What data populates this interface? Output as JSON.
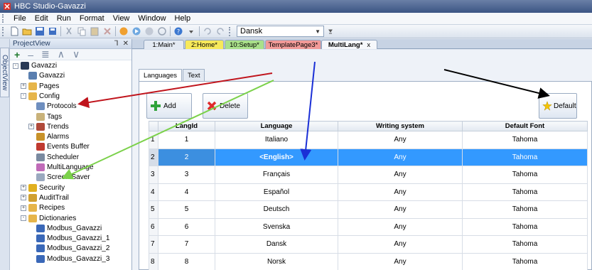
{
  "window": {
    "title": "HBC Studio-Gavazzi"
  },
  "menu": [
    "File",
    "Edit",
    "Run",
    "Format",
    "View",
    "Window",
    "Help"
  ],
  "toolbar": {
    "language_selected": "Dansk"
  },
  "side_tab": {
    "label": "ObjectView"
  },
  "project_view": {
    "title": "ProjectView",
    "pin": "⅂",
    "close": "✕",
    "tree": [
      {
        "label": "Gavazzi",
        "exp": "-",
        "icon": "monitor-icon"
      },
      {
        "label": "Gavazzi",
        "exp": "",
        "icon": "device-icon"
      },
      {
        "label": "Pages",
        "exp": "+",
        "icon": "folder-icon"
      },
      {
        "label": "Config",
        "exp": "-",
        "icon": "folder-open-icon"
      },
      {
        "label": "Protocols",
        "exp": "",
        "icon": "protocol-icon"
      },
      {
        "label": "Tags",
        "exp": "",
        "icon": "tags-icon"
      },
      {
        "label": "Trends",
        "exp": "+",
        "icon": "trends-icon"
      },
      {
        "label": "Alarms",
        "exp": "",
        "icon": "alarm-icon"
      },
      {
        "label": "Events Buffer",
        "exp": "",
        "icon": "events-icon"
      },
      {
        "label": "Scheduler",
        "exp": "",
        "icon": "scheduler-icon"
      },
      {
        "label": "MultiLanguage",
        "exp": "",
        "icon": "multilanguage-icon"
      },
      {
        "label": "Screen Saver",
        "exp": "",
        "icon": "screensaver-icon"
      },
      {
        "label": "Security",
        "exp": "+",
        "icon": "security-icon"
      },
      {
        "label": "AuditTrail",
        "exp": "+",
        "icon": "audittrail-icon"
      },
      {
        "label": "Recipes",
        "exp": "+",
        "icon": "folder-icon"
      },
      {
        "label": "Dictionaries",
        "exp": "-",
        "icon": "folder-open-icon"
      },
      {
        "label": "Modbus_Gavazzi",
        "exp": "",
        "icon": "dictionary-icon"
      },
      {
        "label": "Modbus_Gavazzi_1",
        "exp": "",
        "icon": "dictionary-icon"
      },
      {
        "label": "Modbus_Gavazzi_2",
        "exp": "",
        "icon": "dictionary-icon"
      },
      {
        "label": "Modbus_Gavazzi_3",
        "exp": "",
        "icon": "dictionary-icon"
      }
    ]
  },
  "doc_tabs": [
    {
      "label": "1:Main*",
      "color": "#e4eaf3"
    },
    {
      "label": "2:Home*",
      "color": "#f7e95a"
    },
    {
      "label": "10:Setup*",
      "color": "#a9e08a"
    },
    {
      "label": "TemplatePage3*",
      "color": "#f29a98"
    },
    {
      "label": "MultiLang*",
      "color": "#f6f8fb",
      "close": "x"
    }
  ],
  "inner_tabs": [
    "Languages",
    "Text"
  ],
  "buttons": {
    "add": "Add",
    "delete": "Delete",
    "default": "Default"
  },
  "grid": {
    "columns": [
      "LangId",
      "Language",
      "Writing system",
      "Default Font"
    ],
    "rows": [
      {
        "num": "1",
        "id": "1",
        "language": "Italiano",
        "writing": "Any",
        "font": "Tahoma"
      },
      {
        "num": "2",
        "id": "2",
        "language": "<English>",
        "writing": "Any",
        "font": "Tahoma"
      },
      {
        "num": "3",
        "id": "3",
        "language": "Français",
        "writing": "Any",
        "font": "Tahoma"
      },
      {
        "num": "4",
        "id": "4",
        "language": "Español",
        "writing": "Any",
        "font": "Tahoma"
      },
      {
        "num": "5",
        "id": "5",
        "language": "Deutsch",
        "writing": "Any",
        "font": "Tahoma"
      },
      {
        "num": "6",
        "id": "6",
        "language": "Svenska",
        "writing": "Any",
        "font": "Tahoma"
      },
      {
        "num": "7",
        "id": "7",
        "language": "Dansk",
        "writing": "Any",
        "font": "Tahoma"
      },
      {
        "num": "8",
        "id": "8",
        "language": "Norsk",
        "writing": "Any",
        "font": "Tahoma"
      }
    ]
  },
  "colors": {
    "selection": "#3399ff",
    "arrow_red": "#c0141c",
    "arrow_green": "#7bd14a",
    "arrow_blue": "#1a2fd6",
    "arrow_black": "#000000"
  }
}
